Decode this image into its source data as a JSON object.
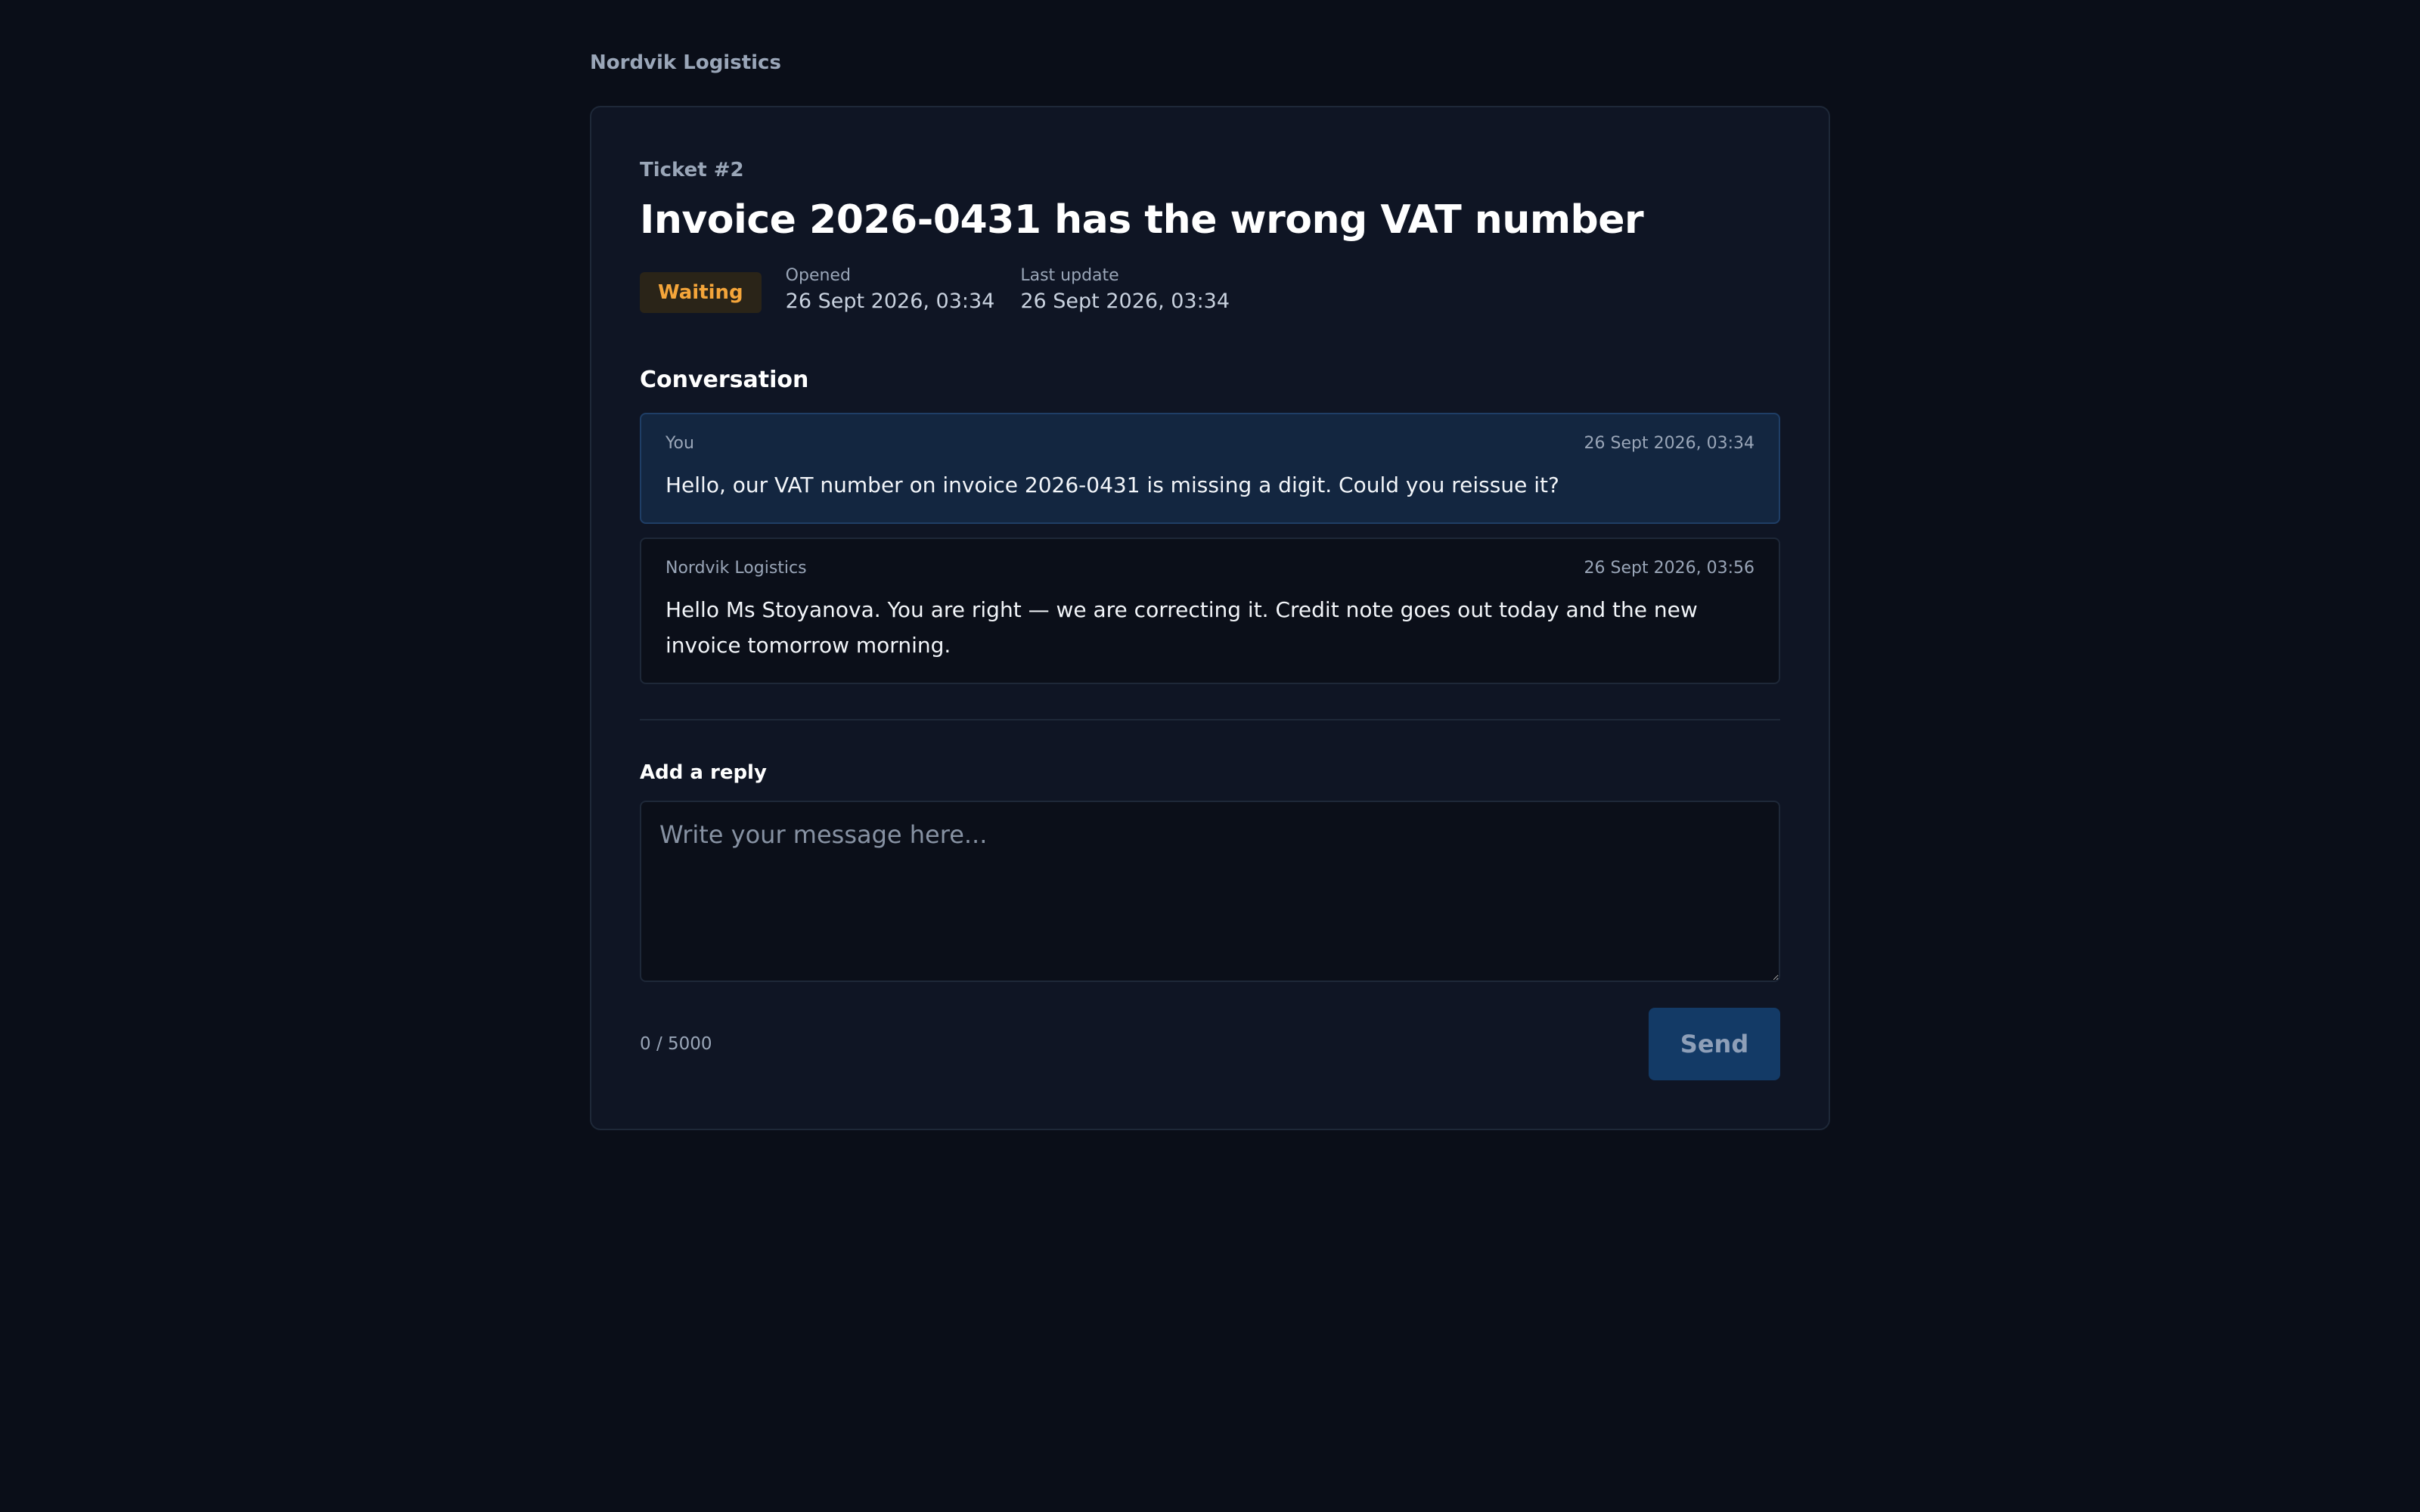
{
  "app": {
    "brand": "Nordvik Logistics"
  },
  "ticket": {
    "id_label": "Ticket #2",
    "title": "Invoice 2026-0431 has the wrong VAT number",
    "status": "Waiting",
    "opened_label": "Opened",
    "opened_value": "26 Sept 2026, 03:34",
    "updated_label": "Last update",
    "updated_value": "26 Sept 2026, 03:34"
  },
  "conversation": {
    "title": "Conversation",
    "messages": [
      {
        "author": "You",
        "time": "26 Sept 2026, 03:34",
        "body": "Hello, our VAT number on invoice 2026-0431 is missing a digit. Could you reissue it?"
      },
      {
        "author": "Nordvik Logistics",
        "time": "26 Sept 2026, 03:56",
        "body": "Hello Ms Stoyanova. You are right — we are correcting it. Credit note goes out today and the new invoice tomorrow morning."
      }
    ]
  },
  "reply": {
    "label": "Add a reply",
    "value": "",
    "placeholder": "Write your message here...",
    "char_count": "0 / 5000",
    "send_label": "Send"
  },
  "colors": {
    "background": "#0a0e18",
    "card": "#0f1524",
    "status_waiting": "#f4a53a",
    "own_message": "#132640",
    "send_button": "#133a66"
  }
}
